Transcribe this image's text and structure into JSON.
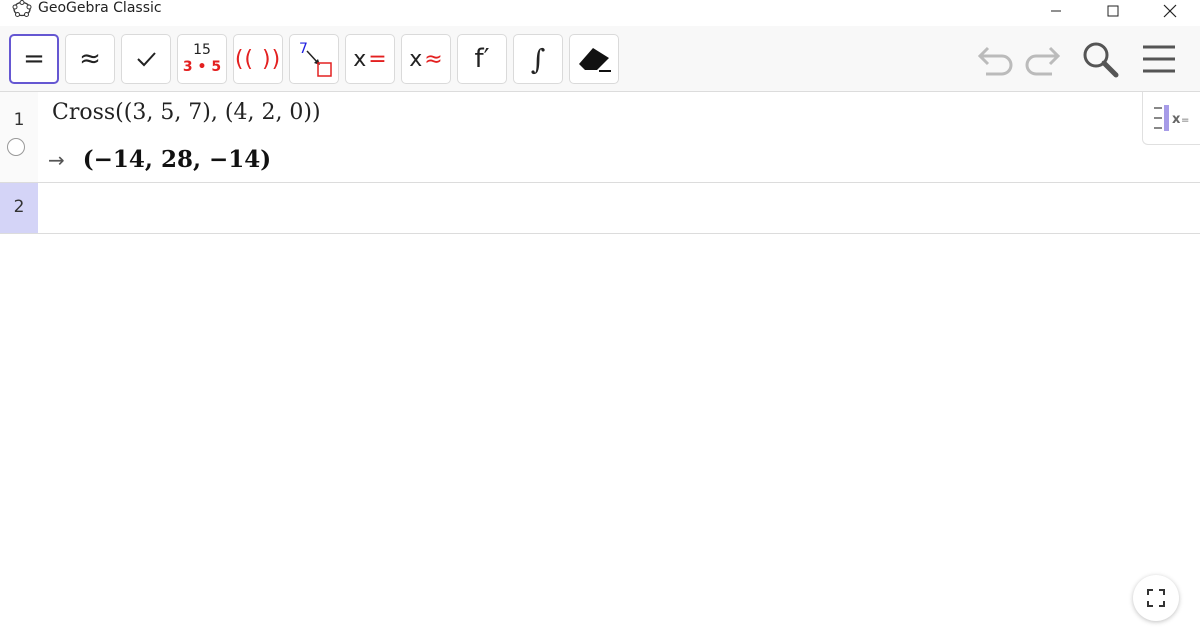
{
  "window": {
    "title": "GeoGebra Classic",
    "controls": [
      "minimize",
      "maximize",
      "close"
    ]
  },
  "toolbar": {
    "buttons": [
      {
        "name": "evaluate",
        "label": "=",
        "selected": true
      },
      {
        "name": "numeric",
        "label": "≈"
      },
      {
        "name": "keep-input",
        "label": "✓"
      },
      {
        "name": "factor",
        "label_top": "15",
        "label_bottom": "3 • 5"
      },
      {
        "name": "expand",
        "label": "(( ))"
      },
      {
        "name": "substitute",
        "label": "7"
      },
      {
        "name": "solve",
        "label_x": "x",
        "label_op": "="
      },
      {
        "name": "solve-numerically",
        "label_x": "x",
        "label_op": "≈"
      },
      {
        "name": "derivative",
        "label": "f′"
      },
      {
        "name": "integral",
        "label": "∫"
      },
      {
        "name": "delete"
      }
    ],
    "right_icons": [
      "undo-icon",
      "redo-icon",
      "search-icon",
      "menu-icon"
    ]
  },
  "algebra": {
    "rows": [
      {
        "number": "1",
        "input": "Cross((3, 5, 7), (4, 2, 0))",
        "output_arrow": "→",
        "output": "(−14, 28, −14)"
      },
      {
        "number": "2",
        "input": ""
      }
    ],
    "side_tab_label": "x="
  },
  "colors": {
    "accent": "#6557d2",
    "active_row": "#d4d4f7",
    "red": "#e32020",
    "blue": "#2020e0"
  }
}
